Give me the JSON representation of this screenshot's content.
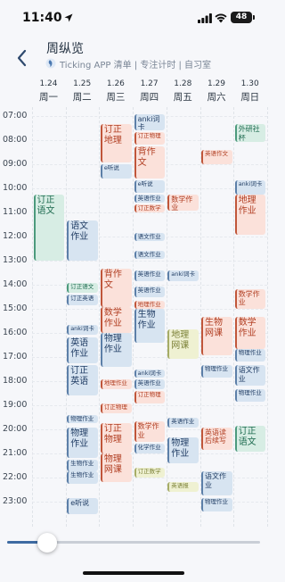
{
  "status_bar": {
    "time": "11:40",
    "battery": "48"
  },
  "header": {
    "title": "周纵览",
    "subtitle": "Ticking APP 清单 | 专注计时 | 自习室"
  },
  "days": [
    {
      "date": "1.24",
      "name": "周一"
    },
    {
      "date": "1.25",
      "name": "周二"
    },
    {
      "date": "1.26",
      "name": "周三"
    },
    {
      "date": "1.27",
      "name": "周四"
    },
    {
      "date": "1.28",
      "name": "周五"
    },
    {
      "date": "1.29",
      "name": "周六"
    },
    {
      "date": "1.30",
      "name": "周日"
    }
  ],
  "hours": [
    "07:00",
    "08:00",
    "09:00",
    "10:00",
    "11:00",
    "12:00",
    "13:00",
    "14:00",
    "15:00",
    "16:00",
    "17:00",
    "18:00",
    "19:00",
    "20:00",
    "21:00",
    "22:00",
    "23:00"
  ],
  "colors": {
    "orange": "#fbe1da",
    "blue": "#d7e4f1",
    "green": "#d7ede4",
    "yellow": "#eff1d2",
    "accent": "#3e6ba2"
  },
  "events": [
    {
      "day": 0,
      "start": "10:15",
      "end": "13:00",
      "title": "订正语文",
      "color": "green"
    },
    {
      "day": 1,
      "start": "11:20",
      "end": "13:00",
      "title": "语文作业",
      "color": "blue"
    },
    {
      "day": 1,
      "start": "13:55",
      "end": "14:20",
      "title": "订正语文",
      "color": "green"
    },
    {
      "day": 1,
      "start": "14:25",
      "end": "14:50",
      "title": "订正英语",
      "color": "blue"
    },
    {
      "day": 1,
      "start": "15:40",
      "end": "16:05",
      "title": "anki词卡",
      "color": "blue"
    },
    {
      "day": 1,
      "start": "16:10",
      "end": "17:15",
      "title": "英语作业",
      "color": "blue"
    },
    {
      "day": 1,
      "start": "17:20",
      "end": "18:35",
      "title": "订正英语",
      "color": "blue"
    },
    {
      "day": 1,
      "start": "19:25",
      "end": "19:45",
      "title": "物理作业",
      "color": "blue"
    },
    {
      "day": 1,
      "start": "19:55",
      "end": "21:10",
      "title": "物理作业",
      "color": "blue"
    },
    {
      "day": 1,
      "start": "21:15",
      "end": "21:45",
      "title": "生物作业",
      "color": "blue"
    },
    {
      "day": 1,
      "start": "21:45",
      "end": "22:15",
      "title": "生物作业",
      "color": "blue"
    },
    {
      "day": 1,
      "start": "22:50",
      "end": "23:30",
      "title": "e听说",
      "color": "blue"
    },
    {
      "day": 2,
      "start": "07:20",
      "end": "08:55",
      "title": "订正地理",
      "color": "orange"
    },
    {
      "day": 2,
      "start": "09:00",
      "end": "09:35",
      "title": "e听说",
      "color": "blue"
    },
    {
      "day": 2,
      "start": "13:20",
      "end": "14:55",
      "title": "背作文",
      "color": "orange"
    },
    {
      "day": 2,
      "start": "14:55",
      "end": "16:00",
      "title": "数学作业",
      "color": "orange"
    },
    {
      "day": 2,
      "start": "16:00",
      "end": "17:25",
      "title": "物理作业",
      "color": "blue"
    },
    {
      "day": 2,
      "start": "17:55",
      "end": "18:20",
      "title": "地理作业",
      "color": "orange"
    },
    {
      "day": 2,
      "start": "18:55",
      "end": "19:20",
      "title": "订正物理",
      "color": "orange"
    },
    {
      "day": 2,
      "start": "19:45",
      "end": "21:00",
      "title": "订正物理",
      "color": "orange"
    },
    {
      "day": 2,
      "start": "21:00",
      "end": "22:10",
      "title": "物理网课",
      "color": "orange"
    },
    {
      "day": 3,
      "start": "06:55",
      "end": "07:35",
      "title": "anki词卡",
      "color": "blue"
    },
    {
      "day": 3,
      "start": "07:40",
      "end": "08:10",
      "title": "订正物理",
      "color": "orange"
    },
    {
      "day": 3,
      "start": "08:15",
      "end": "09:35",
      "title": "背作文",
      "color": "orange"
    },
    {
      "day": 3,
      "start": "09:40",
      "end": "10:10",
      "title": "e听说",
      "color": "blue"
    },
    {
      "day": 3,
      "start": "10:15",
      "end": "10:35",
      "title": "英语作业",
      "color": "blue"
    },
    {
      "day": 3,
      "start": "10:40",
      "end": "11:00",
      "title": "订正数学",
      "color": "orange"
    },
    {
      "day": 3,
      "start": "11:50",
      "end": "12:10",
      "title": "语文作业",
      "color": "blue"
    },
    {
      "day": 3,
      "start": "12:35",
      "end": "12:55",
      "title": "语文作业",
      "color": "blue"
    },
    {
      "day": 3,
      "start": "13:25",
      "end": "13:50",
      "title": "英语作业",
      "color": "blue"
    },
    {
      "day": 3,
      "start": "14:05",
      "end": "14:30",
      "title": "英语作业",
      "color": "blue"
    },
    {
      "day": 3,
      "start": "14:40",
      "end": "15:00",
      "title": "地理作业",
      "color": "orange"
    },
    {
      "day": 3,
      "start": "15:00",
      "end": "16:25",
      "title": "生物作业",
      "color": "blue"
    },
    {
      "day": 3,
      "start": "17:30",
      "end": "17:50",
      "title": "anki词卡",
      "color": "blue"
    },
    {
      "day": 3,
      "start": "17:55",
      "end": "18:20",
      "title": "英语作业",
      "color": "blue"
    },
    {
      "day": 3,
      "start": "18:25",
      "end": "18:55",
      "title": "订正物理",
      "color": "orange"
    },
    {
      "day": 3,
      "start": "19:40",
      "end": "20:30",
      "title": "数学作业",
      "color": "orange"
    },
    {
      "day": 3,
      "start": "20:35",
      "end": "21:00",
      "title": "化学作业",
      "color": "blue"
    },
    {
      "day": 3,
      "start": "21:35",
      "end": "22:00",
      "title": "订正数学",
      "color": "yellow"
    },
    {
      "day": 4,
      "start": "10:15",
      "end": "10:55",
      "title": "数学作业",
      "color": "orange"
    },
    {
      "day": 4,
      "start": "13:25",
      "end": "13:50",
      "title": "anki词卡",
      "color": "blue"
    },
    {
      "day": 4,
      "start": "15:50",
      "end": "17:05",
      "title": "地理网课",
      "color": "yellow"
    },
    {
      "day": 4,
      "start": "19:30",
      "end": "19:55",
      "title": "英语作业",
      "color": "blue"
    },
    {
      "day": 4,
      "start": "20:20",
      "end": "21:25",
      "title": "物理作业",
      "color": "blue"
    },
    {
      "day": 4,
      "start": "22:10",
      "end": "22:35",
      "title": "英语报",
      "color": "yellow"
    },
    {
      "day": 5,
      "start": "08:25",
      "end": "09:00",
      "title": "英语作文",
      "color": "orange"
    },
    {
      "day": 5,
      "start": "15:20",
      "end": "16:55",
      "title": "生物网课",
      "color": "orange"
    },
    {
      "day": 5,
      "start": "17:20",
      "end": "17:50",
      "title": "物理作业",
      "color": "blue"
    },
    {
      "day": 5,
      "start": "19:55",
      "end": "20:50",
      "title": "英语读后续写",
      "color": "orange"
    },
    {
      "day": 5,
      "start": "21:45",
      "end": "22:45",
      "title": "语文作业",
      "color": "blue"
    },
    {
      "day": 5,
      "start": "22:50",
      "end": "23:25",
      "title": "物理作业",
      "color": "blue"
    },
    {
      "day": 6,
      "start": "07:20",
      "end": "08:05",
      "title": "外研社杯",
      "color": "green"
    },
    {
      "day": 6,
      "start": "09:40",
      "end": "10:15",
      "title": "anki词卡",
      "color": "blue"
    },
    {
      "day": 6,
      "start": "10:15",
      "end": "11:55",
      "title": "地理作业",
      "color": "orange"
    },
    {
      "day": 6,
      "start": "14:10",
      "end": "15:00",
      "title": "数学作业",
      "color": "orange"
    },
    {
      "day": 6,
      "start": "15:20",
      "end": "16:40",
      "title": "数学作业",
      "color": "orange"
    },
    {
      "day": 6,
      "start": "16:40",
      "end": "17:10",
      "title": "物理作业",
      "color": "blue"
    },
    {
      "day": 6,
      "start": "17:20",
      "end": "18:10",
      "title": "语文作业",
      "color": "blue"
    },
    {
      "day": 6,
      "start": "18:20",
      "end": "18:50",
      "title": "物理作业",
      "color": "blue"
    },
    {
      "day": 6,
      "start": "19:50",
      "end": "20:55",
      "title": "订正语文",
      "color": "green"
    }
  ],
  "slider": {
    "value": 0.16
  }
}
